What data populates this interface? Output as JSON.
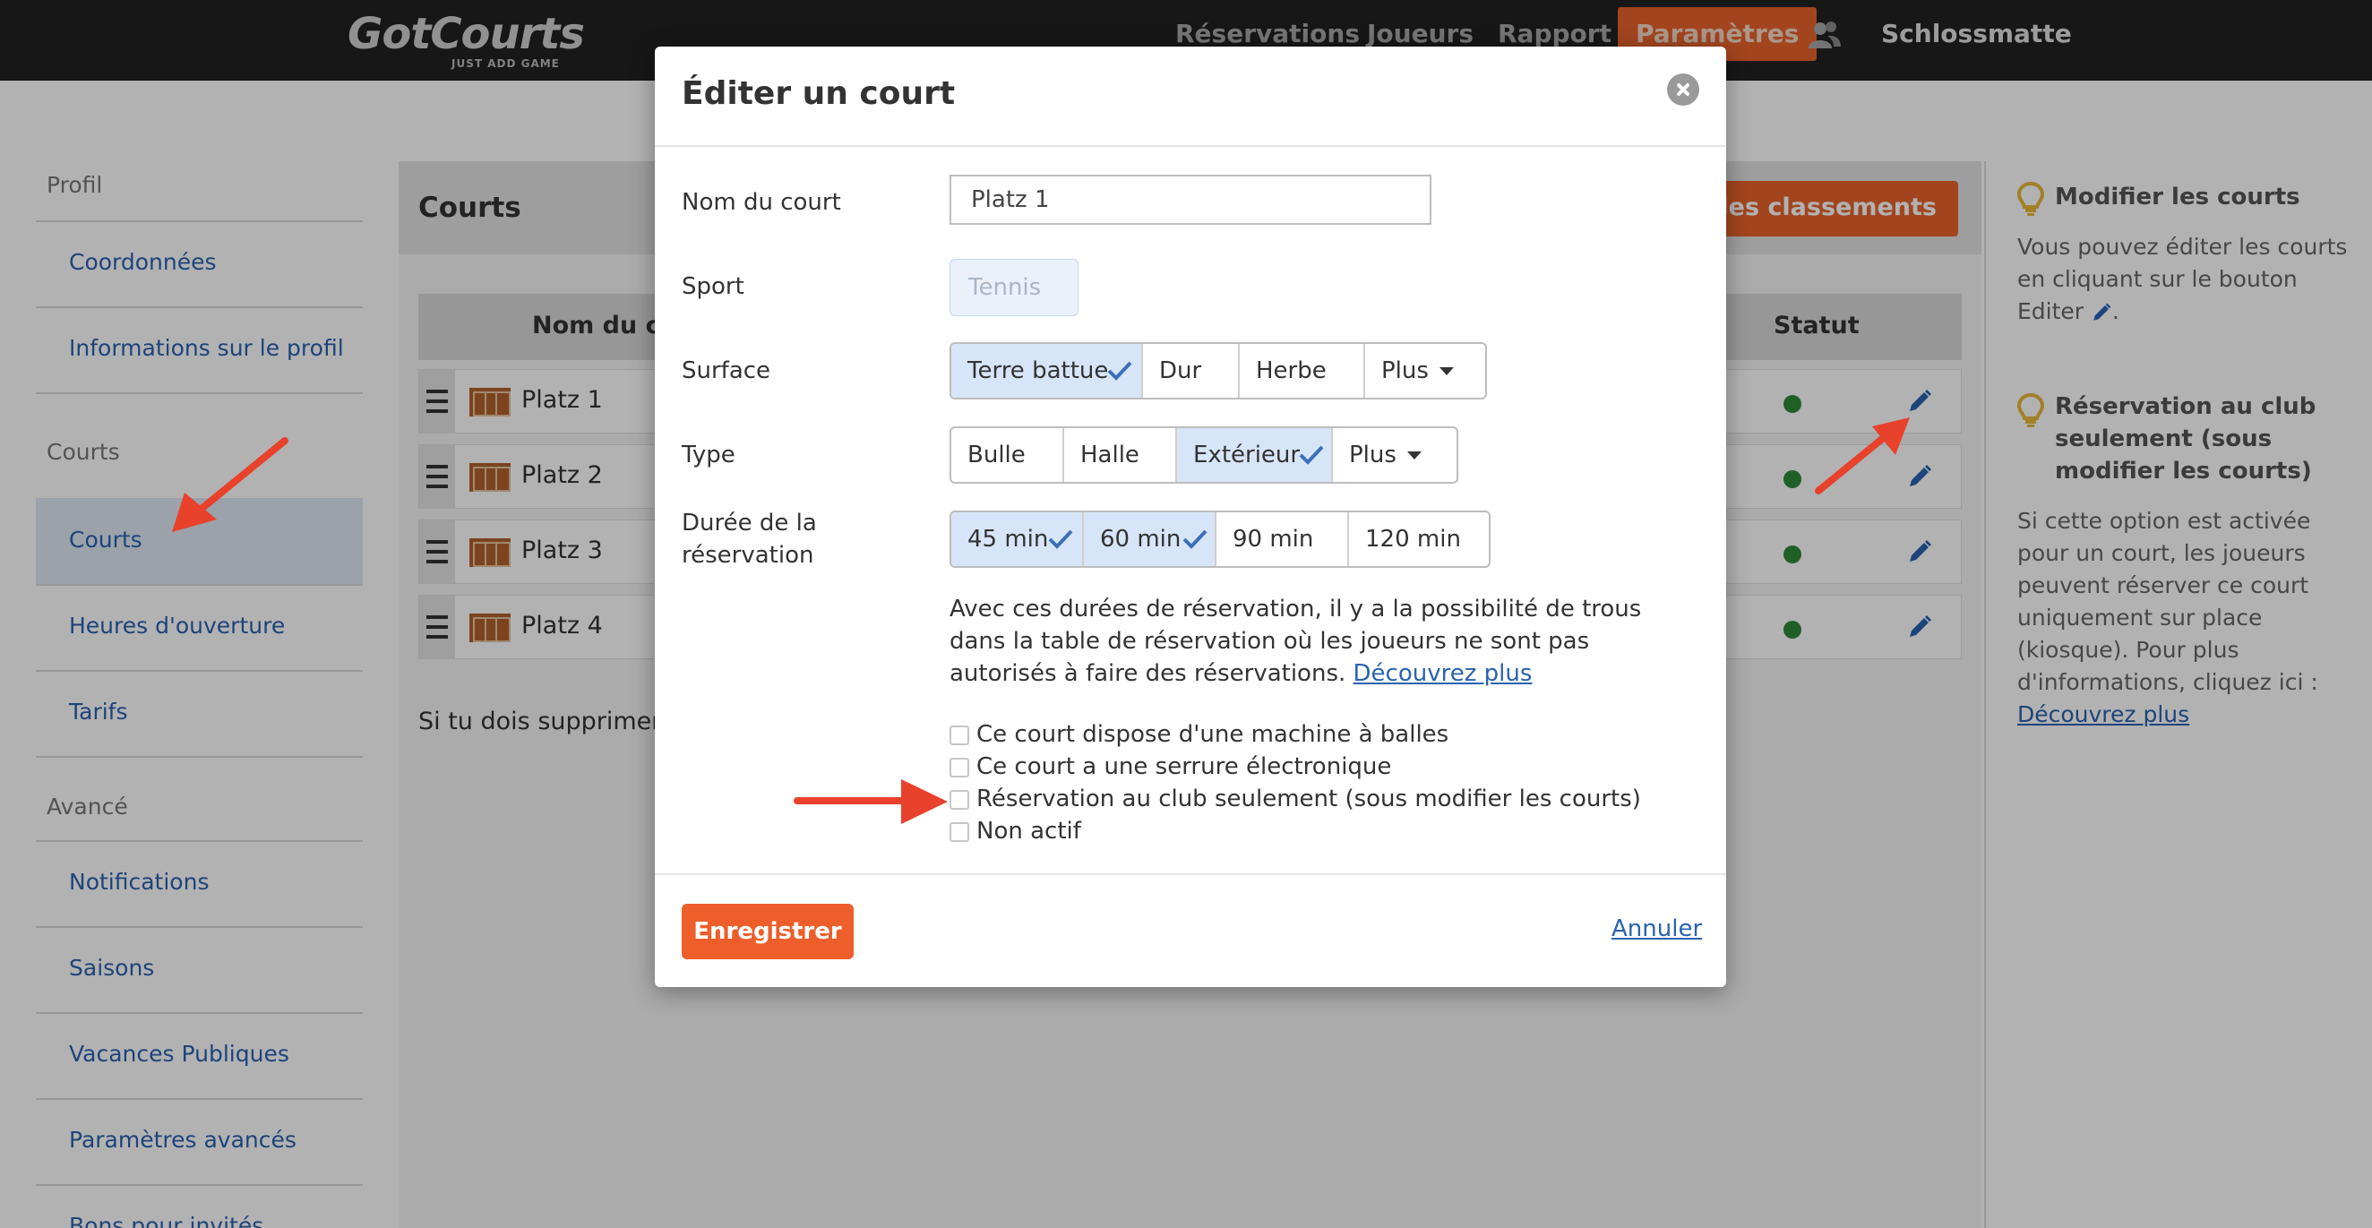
{
  "nav": {
    "logo": "GotCourts",
    "tagline": "JUST ADD GAME",
    "items": [
      "Réservations",
      "Joueurs",
      "Rapport",
      "Paramètres"
    ],
    "active_item": "Paramètres",
    "user_icon": "users-icon",
    "club": "Schlossmatte"
  },
  "sidebar": {
    "profil_header": "Profil",
    "profil_items": [
      "Coordonnées",
      "Informations sur le profil"
    ],
    "courts_header": "Courts",
    "courts_items": [
      "Courts",
      "Heures d'ouverture",
      "Tarifs"
    ],
    "advanced_header": "Avancé",
    "advanced_items": [
      "Notifications",
      "Saisons",
      "Vacances Publiques",
      "Paramètres avancés",
      "Bons pour invités"
    ],
    "active_item": "Courts"
  },
  "main": {
    "title": "Courts",
    "ranking_button": "er des classements",
    "columns": {
      "name": "Nom du co",
      "status": "Statut"
    },
    "rows": [
      {
        "name": "Platz 1"
      },
      {
        "name": "Platz 2"
      },
      {
        "name": "Platz 3"
      },
      {
        "name": "Platz 4"
      }
    ],
    "delete_note": "Si tu dois supprimer l'",
    "status_color": "#2f8a3a"
  },
  "help": {
    "edit_title": "Modifier les courts",
    "edit_text": "Vous pouvez éditer les courts en cliquant sur le bouton Editer",
    "club_title": "Réservation au club seulement (sous modifier les courts)",
    "club_text": "Si cette option est activée pour un court, les joueurs peuvent réserver ce court uniquement sur place (kiosque). Pour plus d'informations, cliquez ici :",
    "club_link": "Découvrez plus"
  },
  "modal": {
    "title": "Éditer un court",
    "labels": {
      "name": "Nom du court",
      "sport": "Sport",
      "surface": "Surface",
      "type": "Type",
      "duration": "Durée de la réservation"
    },
    "name_value": "Platz 1",
    "sport_value": "Tennis",
    "surface_options": [
      "Terre battue",
      "Dur",
      "Herbe",
      "Plus"
    ],
    "type_options": [
      "Bulle",
      "Halle",
      "Extérieur",
      "Plus"
    ],
    "duration_options": [
      "45 min",
      "60 min",
      "90 min",
      "120 min"
    ],
    "description": "Avec ces durées de réservation, il y a la possibilité de trous dans la table de réservation où les joueurs ne sont pas autorisés à faire des réservations.",
    "description_link": "Découvrez plus",
    "checkboxes": [
      "Ce court dispose d'une machine à balles",
      "Ce court a une serrure électronique",
      "Réservation au club seulement (sous modifier les courts)",
      "Non actif"
    ],
    "save": "Enregistrer",
    "cancel": "Annuler"
  },
  "colors": {
    "accent": "#e8642c",
    "link": "#2a62b0",
    "selected": "#d7e5f8",
    "annotation": "#e8412c"
  }
}
